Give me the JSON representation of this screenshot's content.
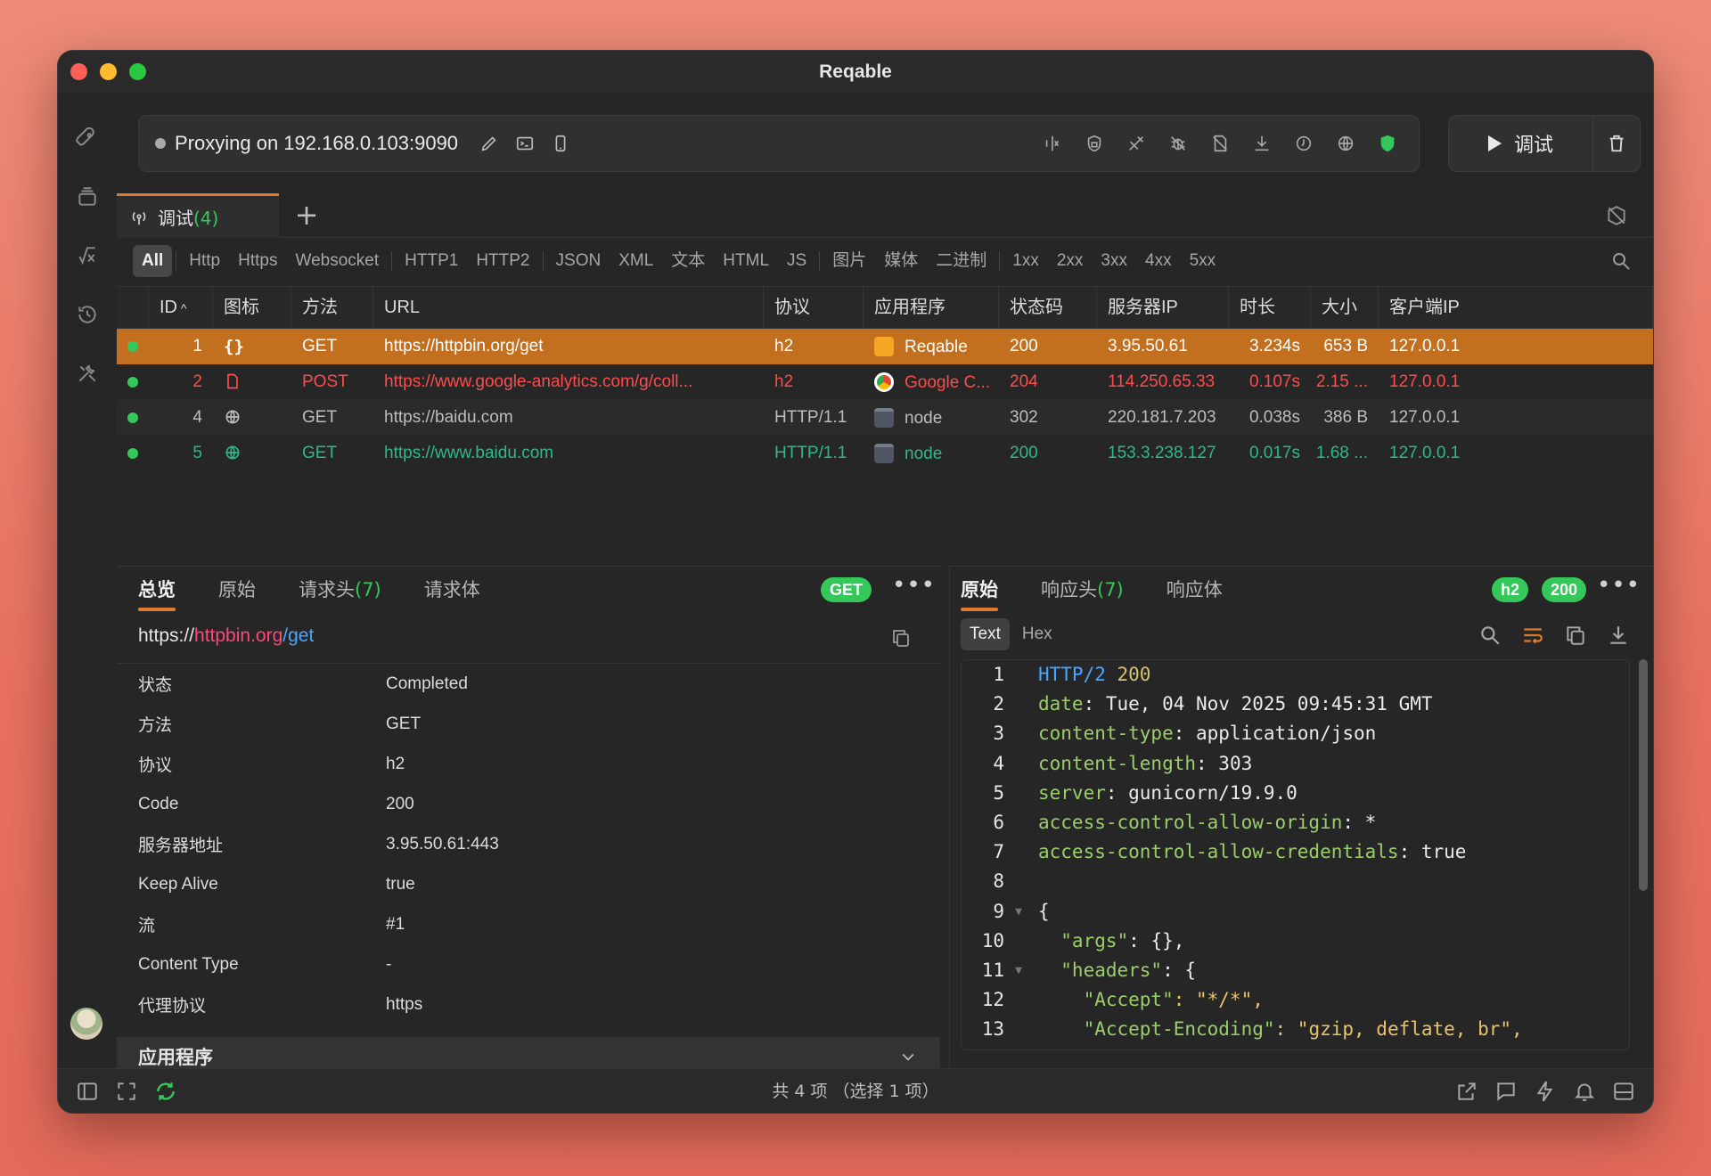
{
  "window": {
    "title": "Reqable"
  },
  "proxy": {
    "text": "Proxying on 192.168.0.103:9090"
  },
  "toolbar": {
    "debug_label": "调试"
  },
  "session_tab": {
    "label": "调试",
    "count": "(4)",
    "add": "+"
  },
  "filters": [
    "All",
    "Http",
    "Https",
    "Websocket",
    "HTTP1",
    "HTTP2",
    "JSON",
    "XML",
    "文本",
    "HTML",
    "JS",
    "图片",
    "媒体",
    "二进制",
    "1xx",
    "2xx",
    "3xx",
    "4xx",
    "5xx"
  ],
  "table": {
    "columns": [
      "ID",
      "图标",
      "方法",
      "URL",
      "协议",
      "应用程序",
      "状态码",
      "服务器IP",
      "时长",
      "大小",
      "客户端IP"
    ],
    "rows": [
      {
        "id": "1",
        "icon": "json-icon",
        "method": "GET",
        "url": "https://httpbin.org/get",
        "protocol": "h2",
        "app": "Reqable",
        "status": "200",
        "server_ip": "3.95.50.61",
        "duration": "3.234s",
        "size": "653 B",
        "client_ip": "127.0.0.1"
      },
      {
        "id": "2",
        "icon": "document-icon",
        "method": "POST",
        "url": "https://www.google-analytics.com/g/coll...",
        "protocol": "h2",
        "app": "Google C...",
        "status": "204",
        "server_ip": "114.250.65.33",
        "duration": "0.107s",
        "size": "2.15 ...",
        "client_ip": "127.0.0.1"
      },
      {
        "id": "4",
        "icon": "globe-icon",
        "method": "GET",
        "url": "https://baidu.com",
        "protocol": "HTTP/1.1",
        "app": "node",
        "status": "302",
        "server_ip": "220.181.7.203",
        "duration": "0.038s",
        "size": "386 B",
        "client_ip": "127.0.0.1"
      },
      {
        "id": "5",
        "icon": "globe-icon",
        "method": "GET",
        "url": "https://www.baidu.com",
        "protocol": "HTTP/1.1",
        "app": "node",
        "status": "200",
        "server_ip": "153.3.238.127",
        "duration": "0.017s",
        "size": "1.68 ...",
        "client_ip": "127.0.0.1"
      }
    ]
  },
  "request_pane": {
    "tabs": [
      "总览",
      "原始",
      "请求头",
      "请求体"
    ],
    "headers_count": "(7)",
    "method_badge": "GET",
    "url": {
      "scheme": "https://",
      "host": "httpbin.org",
      "path": "/get"
    },
    "fields": [
      {
        "key": "状态",
        "value": "Completed"
      },
      {
        "key": "方法",
        "value": "GET"
      },
      {
        "key": "协议",
        "value": "h2"
      },
      {
        "key": "Code",
        "value": "200"
      },
      {
        "key": "服务器地址",
        "value": "3.95.50.61:443"
      },
      {
        "key": "Keep Alive",
        "value": "true"
      },
      {
        "key": "流",
        "value": "#1"
      },
      {
        "key": "Content Type",
        "value": "-"
      },
      {
        "key": "代理协议",
        "value": "https"
      }
    ],
    "section": "应用程序"
  },
  "response_pane": {
    "tabs": [
      "原始",
      "响应头",
      "响应体"
    ],
    "headers_count": "(7)",
    "protocol_badge": "h2",
    "status_badge": "200",
    "subtabs": [
      "Text",
      "Hex"
    ],
    "lines": [
      {
        "n": "1",
        "key": "HTTP/2",
        "val": " 200"
      },
      {
        "n": "2",
        "key": "date",
        "val": ": Tue, 04 Nov 2025 09:45:31 GMT"
      },
      {
        "n": "3",
        "key": "content-type",
        "val": ": application/json"
      },
      {
        "n": "4",
        "key": "content-length",
        "val": ": 303"
      },
      {
        "n": "5",
        "key": "server",
        "val": ": gunicorn/19.9.0"
      },
      {
        "n": "6",
        "key": "access-control-allow-origin",
        "val": ": *"
      },
      {
        "n": "7",
        "key": "access-control-allow-credentials",
        "val": ": true"
      },
      {
        "n": "8",
        "key": "",
        "val": ""
      },
      {
        "n": "9",
        "key": "",
        "val": "{"
      },
      {
        "n": "10",
        "key": "  \"args\"",
        "val": ": {},"
      },
      {
        "n": "11",
        "key": "  \"headers\"",
        "val": ": {"
      },
      {
        "n": "12",
        "key": "    \"Accept\"",
        "val": ": \"*/*\","
      },
      {
        "n": "13",
        "key": "    \"Accept-Encoding\"",
        "val": ": \"gzip, deflate, br\","
      }
    ]
  },
  "statusbar": {
    "summary": "共 4 项 （选择 1 项）"
  }
}
